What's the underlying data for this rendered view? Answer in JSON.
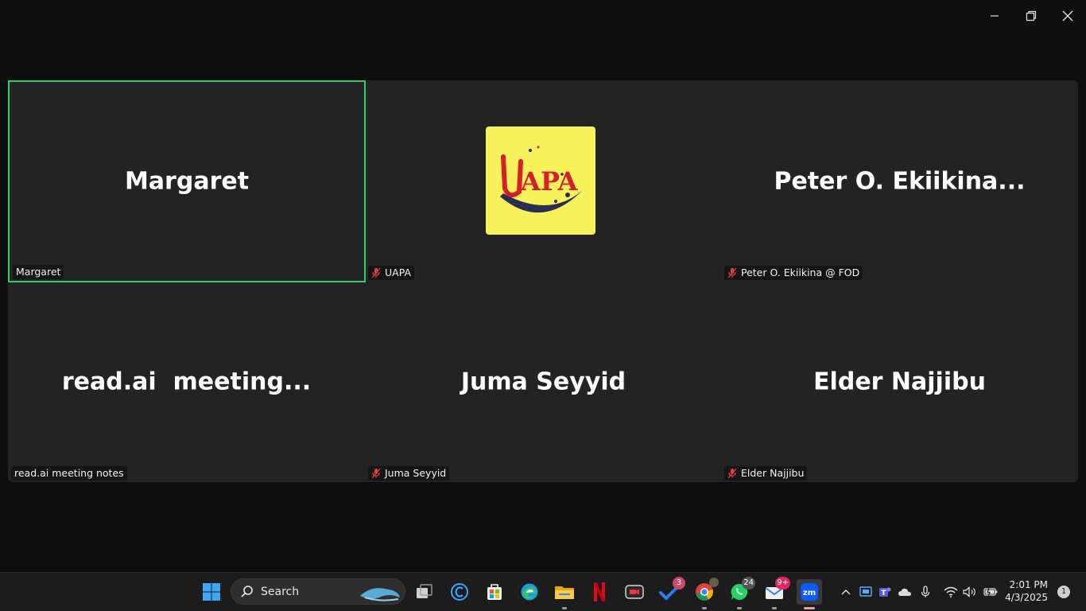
{
  "window": {
    "controls": [
      "minimize",
      "restore",
      "close"
    ]
  },
  "meeting": {
    "tiles": [
      {
        "display_name": "Margaret",
        "label": "Margaret",
        "muted": false,
        "active": true
      },
      {
        "display_name": "",
        "label": "UAPA",
        "muted": true,
        "avatar_logo": "UAPA"
      },
      {
        "display_name": "Peter O. Ekiikina...",
        "label": "Peter O. Ekiikina @ FOD",
        "muted": true
      },
      {
        "display_name": "read.ai  meeting...",
        "label": "read.ai meeting notes",
        "muted": false
      },
      {
        "display_name": "Juma Seyyid",
        "label": "Juma Seyyid",
        "muted": true
      },
      {
        "display_name": "Elder Najjibu",
        "label": "Elder Najjibu",
        "muted": true
      }
    ],
    "active_border_color": "#2ecc71"
  },
  "taskbar": {
    "search_label": "Search",
    "badges": {
      "todo": "3",
      "whatsapp": "24",
      "mail": "9+"
    },
    "clock_time": "2:01 PM",
    "clock_date": "4/3/2025",
    "notification_count": "1",
    "colors": {
      "zoom": "#0b5cff",
      "netflix": "#e50914",
      "whatsapp": "#25d366"
    }
  }
}
